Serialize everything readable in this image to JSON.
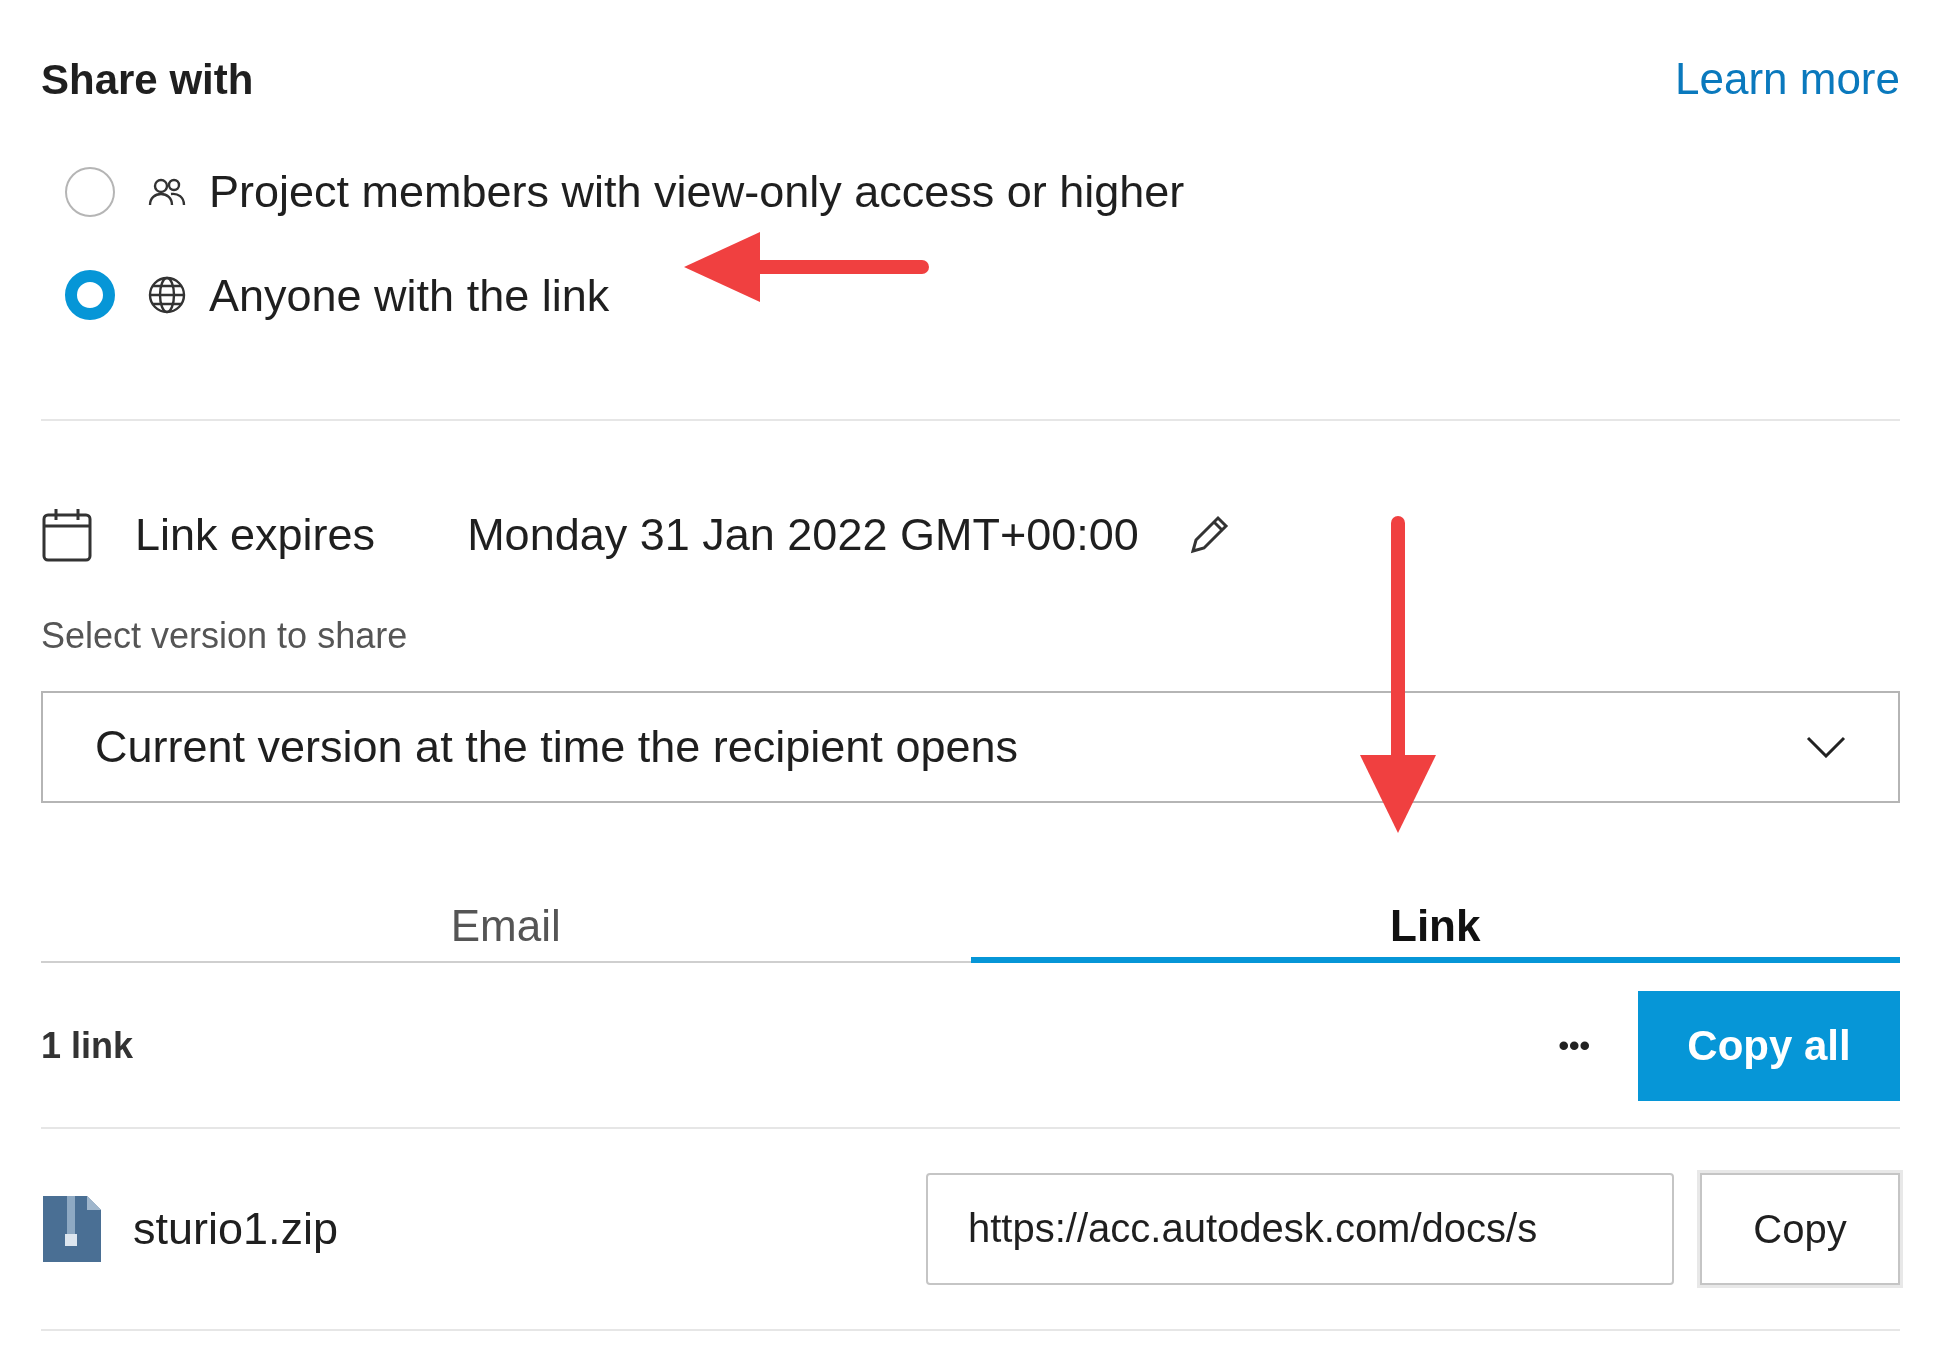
{
  "header": {
    "title": "Share with",
    "learn_more": "Learn more"
  },
  "share_options": [
    {
      "label": "Project members with view-only access or higher",
      "selected": false
    },
    {
      "label": "Anyone with the link",
      "selected": true
    }
  ],
  "expiry": {
    "label": "Link expires",
    "value": "Monday 31 Jan 2022 GMT+00:00"
  },
  "version": {
    "label": "Select version to share",
    "value": "Current version at the time the recipient opens"
  },
  "tabs": [
    {
      "label": "Email",
      "selected": false
    },
    {
      "label": "Link",
      "selected": true
    }
  ],
  "links": {
    "count": "1 link",
    "more": "•••",
    "copy_all": "Copy all",
    "rows": [
      {
        "file": "sturio1.zip",
        "url": "https://acc.autodesk.com/docs/s",
        "copy": "Copy"
      }
    ]
  }
}
